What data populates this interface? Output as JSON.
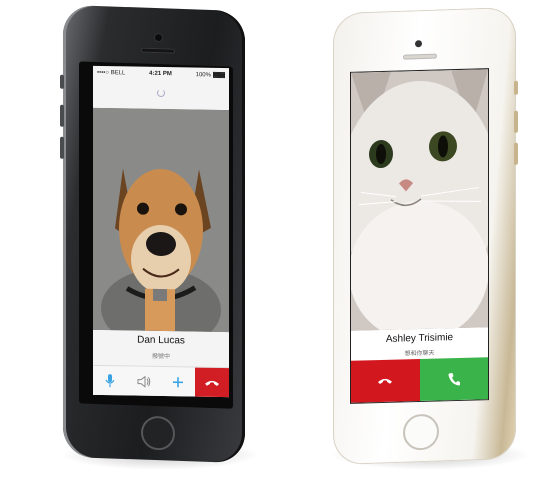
{
  "left_phone": {
    "status_bar": {
      "carrier": "••••○ BELL",
      "time": "4:21 PM",
      "battery": "100%"
    },
    "caller_name": "Dan Lucas",
    "call_status": "撥號中",
    "controls": {
      "mic_icon": "microphone-icon",
      "speaker_icon": "speaker-icon",
      "add_icon": "plus-icon",
      "end_icon": "hang-up-icon"
    },
    "colors": {
      "accent": "#3aa3e3",
      "end_call": "#d11d24"
    }
  },
  "right_phone": {
    "caller_name": "Ashley Trisimie",
    "call_status": "想和你聊天",
    "controls": {
      "decline_icon": "hang-up-icon",
      "accept_icon": "phone-icon"
    },
    "colors": {
      "decline": "#d3171f",
      "accept": "#3ab44a"
    }
  }
}
